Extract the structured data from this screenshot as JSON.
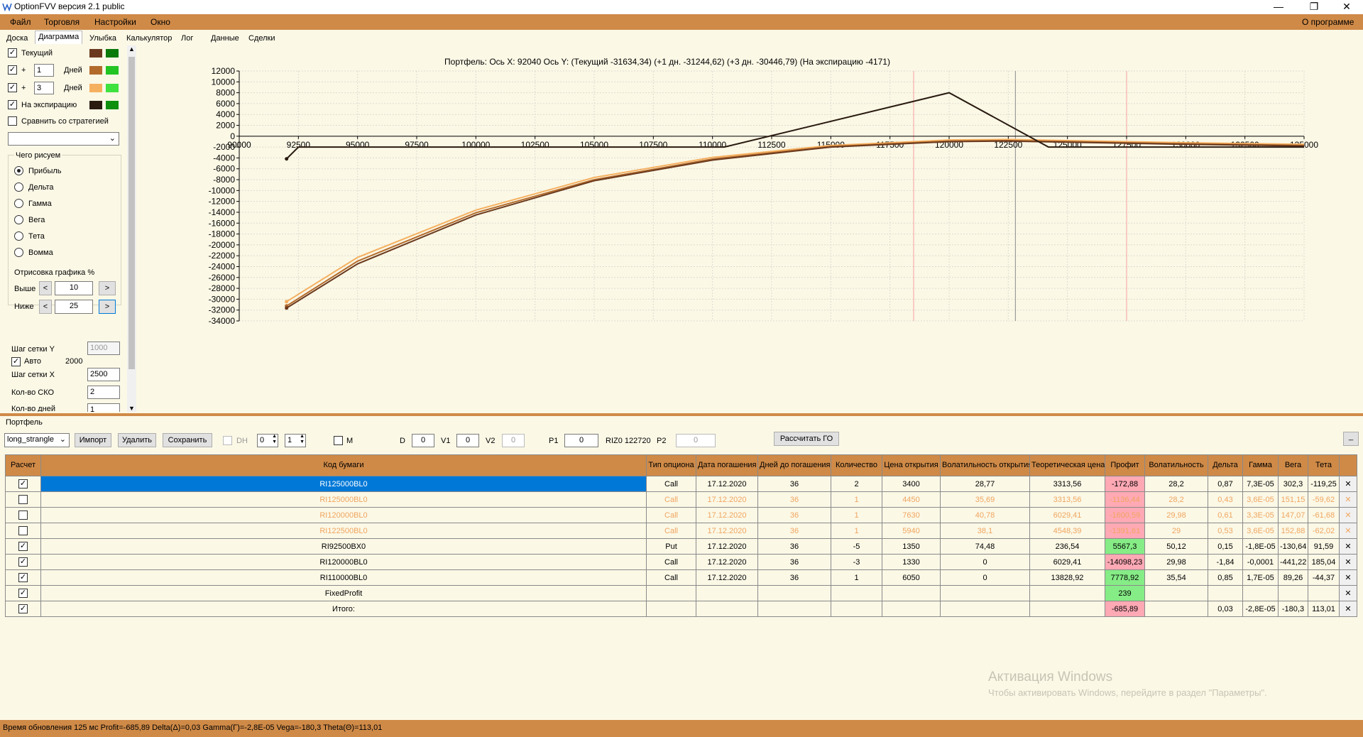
{
  "app": {
    "title": "OptionFVV версия 2.1 public",
    "about": "О программе"
  },
  "menu": [
    "Файл",
    "Торговля",
    "Настройки",
    "Окно"
  ],
  "tabs": [
    "Доска",
    "Диаграмма",
    "Улыбка",
    "Калькулятор",
    "Лог",
    "Данные",
    "Сделки"
  ],
  "active_tab": "Диаграмма",
  "left": {
    "current_label": "Текущий",
    "plus": "+",
    "days1": "1",
    "days2": "3",
    "days_label": "Дней",
    "expiry_label": "На экспирацию",
    "compare_label": "Сравнить со стратегией",
    "draw_group": "Чего рисуем",
    "radios": [
      "Прибыль",
      "Дельта",
      "Гамма",
      "Вега",
      "Тета",
      "Вомма"
    ],
    "range_group": "Отрисовка графика %",
    "above_label": "Выше",
    "above_value": "10",
    "below_label": "Ниже",
    "below_value": "25",
    "btn_less": "<",
    "btn_more": ">",
    "grid_y_label": "Шаг сетки Y",
    "grid_y_value": "1000",
    "auto_label": "Авто",
    "auto_value": "2000",
    "grid_x_label": "Шаг сетки X",
    "grid_x_value": "2500",
    "sko_label": "Кол-во СКО",
    "sko_value": "2",
    "days_cut_label": "Кол-во дней",
    "days_cut_value": "1",
    "colors": {
      "current_a": "#6b3a1e",
      "current_b": "#0a7a0a",
      "plus1_a": "#b36b2c",
      "plus1_b": "#23c423",
      "plus3_a": "#f5b060",
      "plus3_b": "#3fe23f",
      "expiry_a": "#2a1a10",
      "expiry_b": "#0e8f0e"
    }
  },
  "chart_data": {
    "type": "line",
    "title": "Портфель: Ось X:  92040  Ось Y:   (Текущий -31634,34)   (+1 дн. -31244,62)   (+3 дн. -30446,79)   (На экспирацию -4171)",
    "xlim": [
      90000,
      135000
    ],
    "ylim": [
      -34000,
      12000
    ],
    "x_ticks": [
      90000,
      92500,
      95000,
      97500,
      100000,
      102500,
      105000,
      107500,
      110000,
      112500,
      115000,
      117500,
      120000,
      122500,
      125000,
      127500,
      130000,
      132500,
      135000
    ],
    "y_ticks": [
      12000,
      10000,
      8000,
      6000,
      4000,
      2000,
      0,
      -2000,
      -4000,
      -6000,
      -8000,
      -10000,
      -12000,
      -14000,
      -16000,
      -18000,
      -20000,
      -22000,
      -24000,
      -26000,
      -28000,
      -30000,
      -32000,
      -34000
    ],
    "vlines": [
      {
        "x": 118500,
        "color": "#f5a0a0"
      },
      {
        "x": 122800,
        "color": "#8a8a8a"
      },
      {
        "x": 127500,
        "color": "#f5a0a0"
      }
    ],
    "series": [
      {
        "key": "expiry",
        "color": "#2a1a10",
        "x": [
          92000,
          92500,
          110500,
          120000,
          124200,
          135000
        ],
        "y": [
          -4171,
          -2000,
          -2000,
          8000,
          -2000,
          -2000
        ]
      },
      {
        "key": "current",
        "color": "#6b3a1e",
        "x": [
          92000,
          95000,
          100000,
          105000,
          110000,
          115000,
          120000,
          122500,
          125000,
          127500,
          130000,
          135000
        ],
        "y": [
          -31634,
          -23500,
          -14500,
          -8200,
          -4400,
          -2000,
          -1000,
          -900,
          -1100,
          -1300,
          -1500,
          -1800
        ]
      },
      {
        "key": "plus1",
        "color": "#b36b2c",
        "x": [
          92000,
          95000,
          100000,
          105000,
          110000,
          115000,
          120000,
          122500,
          125000,
          127500,
          130000,
          135000
        ],
        "y": [
          -31244,
          -23000,
          -14100,
          -8000,
          -4200,
          -1900,
          -900,
          -800,
          -1000,
          -1200,
          -1400,
          -1700
        ]
      },
      {
        "key": "plus3",
        "color": "#f5b060",
        "x": [
          92000,
          95000,
          100000,
          105000,
          110000,
          115000,
          120000,
          122500,
          125000,
          127500,
          130000,
          135000
        ],
        "y": [
          -30446,
          -22300,
          -13600,
          -7600,
          -3900,
          -1700,
          -700,
          -600,
          -800,
          -1000,
          -1200,
          -1500
        ]
      }
    ]
  },
  "portfolio": {
    "label": "Портфель",
    "strategy": "long_strangle",
    "import_btn": "Импорт",
    "delete_btn": "Удалить",
    "save_btn": "Сохранить",
    "dh_label": "DH",
    "dh_a": "0",
    "dh_b": "1",
    "m_label": "M",
    "d_label": "D",
    "d_value": "0",
    "v1_label": "V1",
    "v1_value": "0",
    "v2_label": "V2",
    "v2_value": "0",
    "p1_label": "P1",
    "p1_value": "0",
    "riz_label": "RIZ0 122720",
    "p2_label": "P2",
    "p2_value": "0",
    "calc_btn": "Рассчитать ГО",
    "min_btn": "_",
    "columns": [
      "Расчет",
      "Код бумаги",
      "Тип опциона",
      "Дата погашения",
      "Дней до погашения",
      "Количество",
      "Цена открытия",
      "Волатильность открытия",
      "Теоретическая цена",
      "Профит",
      "Волатильность",
      "Дельта",
      "Гамма",
      "Вега",
      "Тета",
      ""
    ],
    "rows": [
      {
        "checked": true,
        "style": "sel",
        "cells": [
          "RI125000BL0",
          "Call",
          "17.12.2020",
          "36",
          "2",
          "3400",
          "28,77",
          "3313,56",
          "-172,88",
          "28,2",
          "0,87",
          "7,3E-05",
          "302,3",
          "-119,25"
        ],
        "profit": "neg"
      },
      {
        "checked": false,
        "style": "dim",
        "cells": [
          "RI125000BL0",
          "Call",
          "17.12.2020",
          "36",
          "1",
          "4450",
          "35,69",
          "3313,56",
          "-1136,44",
          "28,2",
          "0,43",
          "3,6E-05",
          "151,15",
          "-59,62"
        ],
        "profit": "negdim"
      },
      {
        "checked": false,
        "style": "dim",
        "cells": [
          "RI120000BL0",
          "Call",
          "17.12.2020",
          "36",
          "1",
          "7630",
          "40,78",
          "6029,41",
          "-1600,59",
          "29,98",
          "0,61",
          "3,3E-05",
          "147,07",
          "-61,68"
        ],
        "profit": "negdim"
      },
      {
        "checked": false,
        "style": "dim",
        "cells": [
          "RI122500BL0",
          "Call",
          "17.12.2020",
          "36",
          "1",
          "5940",
          "38,1",
          "4548,39",
          "-1391,61",
          "29",
          "0,53",
          "3,6E-05",
          "152,88",
          "-62,02"
        ],
        "profit": "negdim"
      },
      {
        "checked": true,
        "style": "",
        "cells": [
          "RI92500BX0",
          "Put",
          "17.12.2020",
          "36",
          "-5",
          "1350",
          "74,48",
          "236,54",
          "5567,3",
          "50,12",
          "0,15",
          "-1,8E-05",
          "-130,64",
          "91,59"
        ],
        "profit": "pos"
      },
      {
        "checked": true,
        "style": "",
        "cells": [
          "RI120000BL0",
          "Call",
          "17.12.2020",
          "36",
          "-3",
          "1330",
          "0",
          "6029,41",
          "-14098,23",
          "29,98",
          "-1,84",
          "-0,0001",
          "-441,22",
          "185,04"
        ],
        "profit": "neg"
      },
      {
        "checked": true,
        "style": "",
        "cells": [
          "RI110000BL0",
          "Call",
          "17.12.2020",
          "36",
          "1",
          "6050",
          "0",
          "13828,92",
          "7778,92",
          "35,54",
          "0,85",
          "1,7E-05",
          "89,26",
          "-44,37"
        ],
        "profit": "pos"
      },
      {
        "checked": true,
        "style": "",
        "cells": [
          "FixedProfit",
          "",
          "",
          "",
          "",
          "",
          "",
          "",
          "239",
          "",
          "",
          "",
          "",
          ""
        ],
        "profit": "pos"
      },
      {
        "checked": true,
        "style": "",
        "cells": [
          "Итого:",
          "",
          "",
          "",
          "",
          "",
          "",
          "",
          "-685,89",
          "",
          "0,03",
          "-2,8E-05",
          "-180,3",
          "113,01"
        ],
        "profit": "neg"
      }
    ],
    "close_glyph": "✕"
  },
  "watermark": {
    "line1": "Активация Windows",
    "line2": "Чтобы активировать Windows, перейдите в раздел \"Параметры\"."
  },
  "status": "Время обновления 125 мс  Profit=-685,89 Delta(Δ)=0,03 Gamma(Γ)=-2,8E-05 Vega=-180,3 Theta(Θ)=113,01"
}
